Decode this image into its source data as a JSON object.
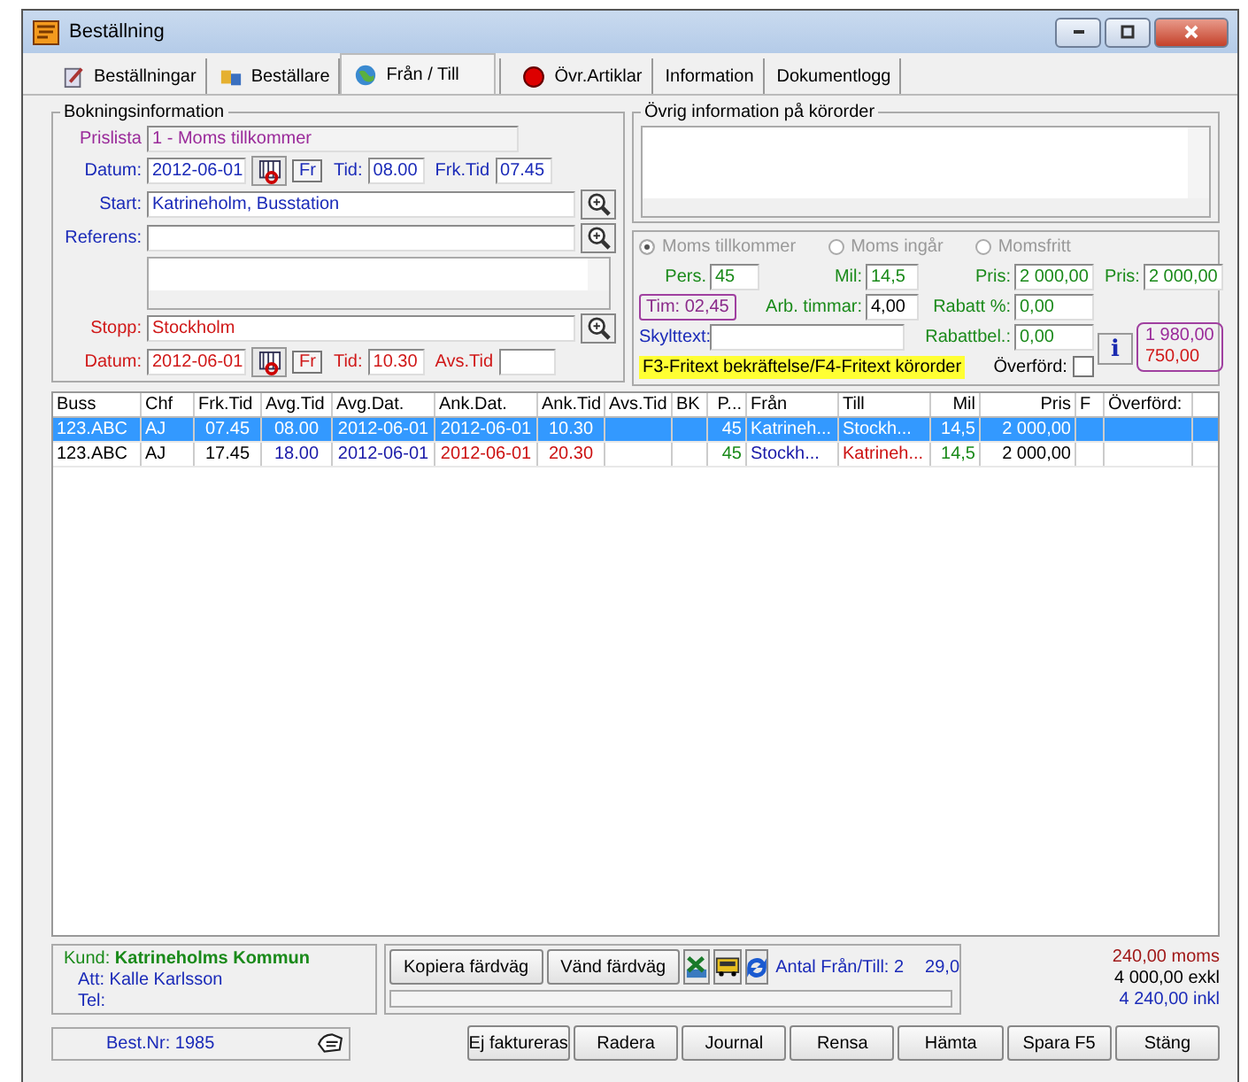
{
  "window": {
    "title": "Beställning"
  },
  "tabs": [
    {
      "label": "Beställningar",
      "selected": false
    },
    {
      "label": "Beställare",
      "selected": false
    },
    {
      "label": "Från / Till",
      "selected": true
    },
    {
      "label": "Övr.Artiklar",
      "selected": false
    },
    {
      "label": "Information",
      "selected": false
    },
    {
      "label": "Dokumentlogg",
      "selected": false
    }
  ],
  "booking": {
    "legend": "Bokningsinformation",
    "prislista": {
      "label": "Prislista",
      "value": "1      - Moms tillkommer"
    },
    "datum": {
      "label": "Datum:",
      "value": "2012-06-01"
    },
    "fr_button": "Fr",
    "tid": {
      "label": "Tid:",
      "value": "08.00"
    },
    "frk_tid": {
      "label": "Frk.Tid",
      "value": "07.45"
    },
    "start": {
      "label": "Start:",
      "value": "Katrineholm, Busstation"
    },
    "referens": {
      "label": "Referens:"
    },
    "stopp": {
      "label": "Stopp:",
      "value": "Stockholm"
    },
    "datum_stopp": {
      "label": "Datum:",
      "value": "2012-06-01"
    },
    "fr_button_stopp": "Fr",
    "tid_stopp": {
      "label": "Tid:",
      "value": "10.30"
    },
    "avs_tid": {
      "label": "Avs.Tid"
    }
  },
  "other_info": {
    "legend": "Övrig information på körorder"
  },
  "pricing": {
    "radios": [
      {
        "label": "Moms tillkommer",
        "selected": true
      },
      {
        "label": "Moms ingår",
        "selected": false
      },
      {
        "label": "Momsfritt",
        "selected": false
      }
    ],
    "pers": {
      "label": "Pers.",
      "value": "45"
    },
    "mil": {
      "label": "Mil:",
      "value": "14,5"
    },
    "pris": {
      "label": "Pris:",
      "value": "2 000,00"
    },
    "pris2": {
      "label": "Pris:",
      "value": "2 000,00"
    },
    "tim": "Tim: 02,45",
    "arb_timmar": {
      "label": "Arb. timmar:",
      "value": "4,00"
    },
    "rabatt": {
      "label": "Rabatt %:",
      "value": "0,00"
    },
    "rabattbel": {
      "label": "Rabattbel.:",
      "value": "0,00"
    },
    "info_button": "i",
    "sum_lines": [
      "1 980,00",
      "750,00"
    ],
    "skylttext": {
      "label": "Skylttext:"
    },
    "hint": "F3-Fritext bekräftelse/F4-Fritext körorder",
    "overford": {
      "label": "Överförd:",
      "checked": false
    }
  },
  "table": {
    "columns": [
      {
        "label": "Buss",
        "kind": "text"
      },
      {
        "label": "Chf",
        "kind": "text"
      },
      {
        "label": "Frk.Tid",
        "kind": "center"
      },
      {
        "label": "Avg.Tid",
        "kind": "center",
        "color": "#1a1aa8"
      },
      {
        "label": "Avg.Dat.",
        "kind": "center",
        "color": "#1a1aa8"
      },
      {
        "label": "Ank.Dat.",
        "kind": "center",
        "color": "#cc1111"
      },
      {
        "label": "Ank.Tid",
        "kind": "center",
        "color": "#cc1111"
      },
      {
        "label": "Avs.Tid",
        "kind": "center"
      },
      {
        "label": "BK",
        "kind": "center"
      },
      {
        "label": "P...",
        "kind": "number",
        "color": "#1a8a1a"
      },
      {
        "label": "Från",
        "kind": "text",
        "color": "#1a1aa8"
      },
      {
        "label": "Till",
        "kind": "text",
        "color": "#cc1111"
      },
      {
        "label": "Mil",
        "kind": "number",
        "color": "#1a8a1a"
      },
      {
        "label": "Pris",
        "kind": "number"
      },
      {
        "label": "F",
        "kind": "text"
      },
      {
        "label": "Överförd:",
        "kind": "text"
      }
    ],
    "rows": [
      {
        "selected": true,
        "cells": [
          "123.ABC",
          "AJ",
          "07.45",
          "08.00",
          "2012-06-01",
          "2012-06-01",
          "10.30",
          "",
          "",
          "45",
          "Katrineh...",
          "Stockh...",
          "14,5",
          "2 000,00",
          "",
          ""
        ]
      },
      {
        "selected": false,
        "cells": [
          "123.ABC",
          "AJ",
          "17.45",
          "18.00",
          "2012-06-01",
          "2012-06-01",
          "20.30",
          "",
          "",
          "45",
          "Stockh...",
          "Katrineh...",
          "14,5",
          "2 000,00",
          "",
          ""
        ]
      }
    ]
  },
  "footer": {
    "kund_label": "Kund:",
    "kund_name": "Katrineholms Kommun",
    "att": "Att: Kalle Karlsson",
    "tel": "Tel:",
    "buttons": [
      "Kopiera färdväg",
      "Vänd färdväg"
    ],
    "antal": "Antal Från/Till: 2",
    "antal_sum": "29,0",
    "progress": {
      "level": 0
    },
    "moms": "240,00 moms",
    "exkl": "4 000,00 exkl",
    "inkl": "4 240,00 inkl"
  },
  "bottom": {
    "best_nr": "Best.Nr: 1985",
    "buttons": [
      "Ej faktureras",
      "Radera",
      "Journal",
      "Rensa",
      "Hämta",
      "Spara F5",
      "Stäng"
    ]
  }
}
